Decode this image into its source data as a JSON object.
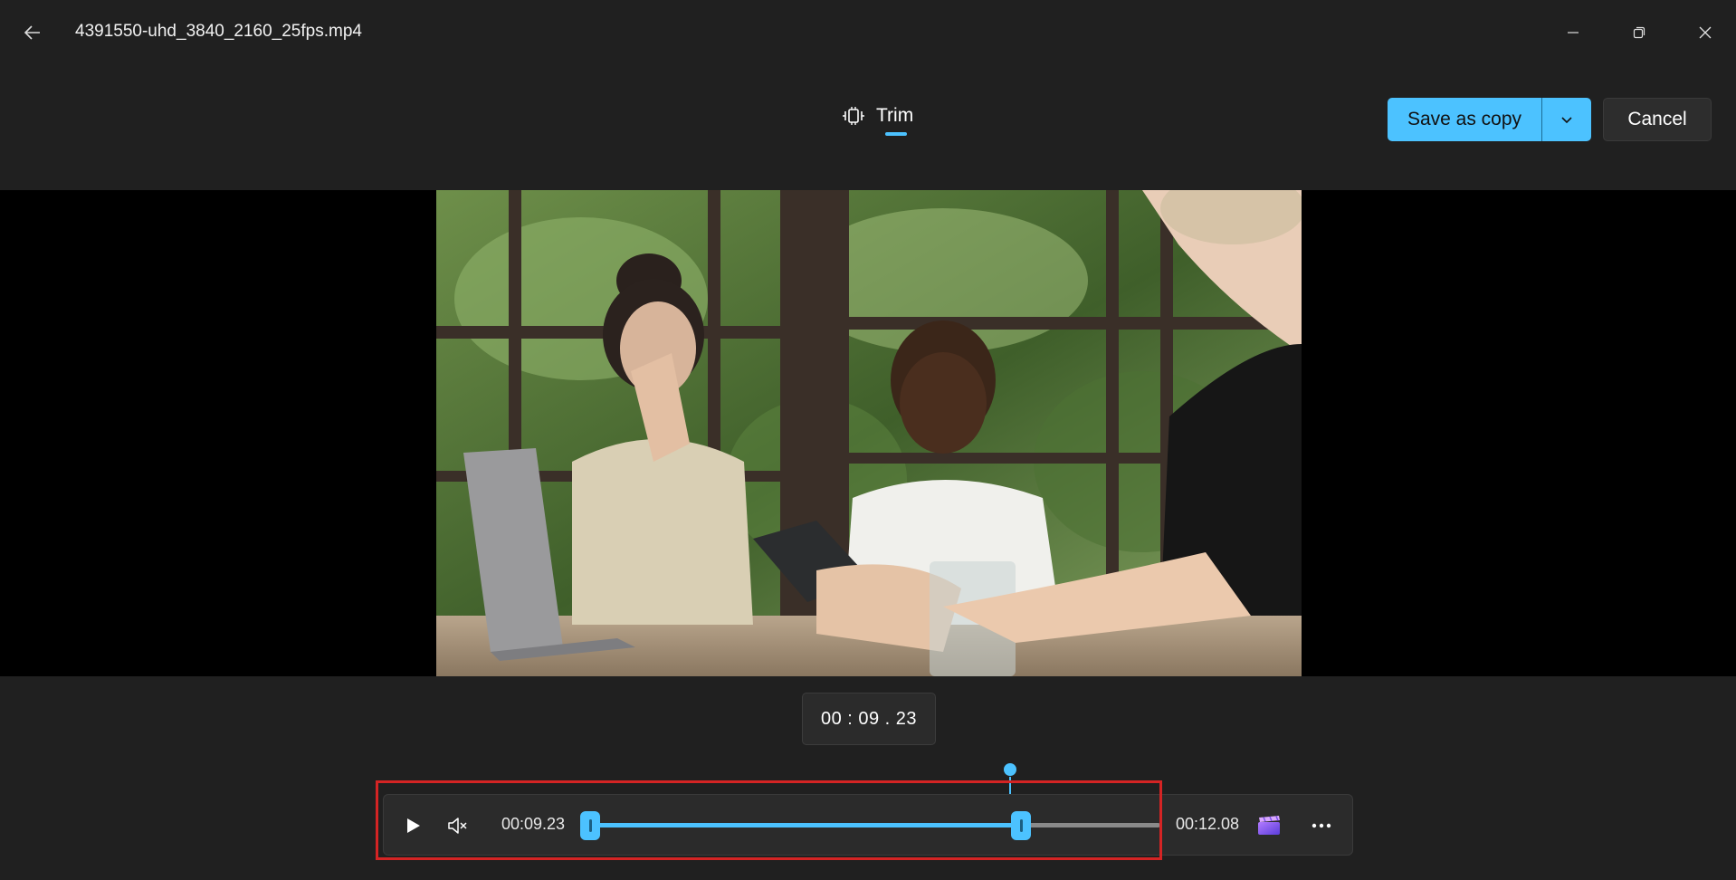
{
  "window": {
    "file_name": "4391550-uhd_3840_2160_25fps.mp4"
  },
  "tabs": [
    {
      "label": "Trim",
      "icon": "trim-icon",
      "active": true
    }
  ],
  "actions": {
    "save_label": "Save as copy",
    "cancel_label": "Cancel"
  },
  "player": {
    "timecode": "00 : 09 . 23",
    "start_time": "00:09.23",
    "end_time": "00:12.08",
    "trim_end_fraction": 0.78,
    "playhead_fraction": 0.77
  },
  "colors": {
    "accent": "#4cc2ff",
    "background": "#202020",
    "highlight": "#d42424"
  }
}
